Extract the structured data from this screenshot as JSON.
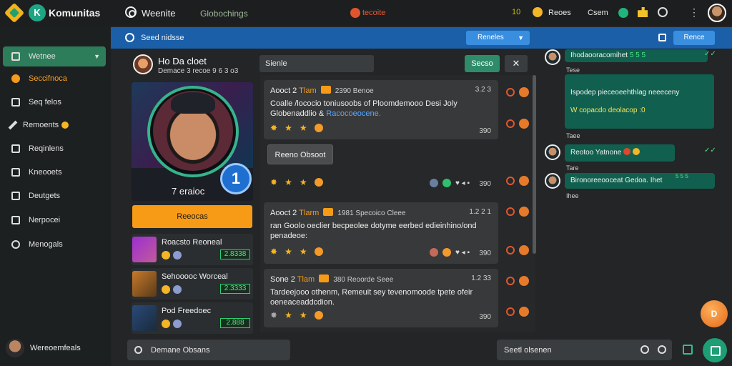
{
  "topbar": {
    "brand": "Komunitas",
    "title": "Weenite",
    "subtitle": "Globochings",
    "status": "tecoite",
    "count": "10",
    "link1": "Reoes",
    "link2": "Csem"
  },
  "sidebar": {
    "items": [
      {
        "label": "Wetnee"
      },
      {
        "label": "Seccifnoca"
      },
      {
        "label": "Seq felos"
      },
      {
        "label": "Remoents"
      },
      {
        "label": "Reqinlens"
      },
      {
        "label": "Kneooets"
      },
      {
        "label": "Deutgets"
      },
      {
        "label": "Nerpocei"
      },
      {
        "label": "Menogals"
      }
    ],
    "user_name": "Wereoemfeals"
  },
  "bluebar": {
    "label": "Seed nidsse",
    "dropdown": "Reneles",
    "button": "Rence"
  },
  "profile": {
    "name": "Ho Da cloet",
    "subtitle": "Demace 3 recoe 9 6 3 o3",
    "hero_label": "7 eraioc",
    "level": "1",
    "action_button": "Reeocas"
  },
  "friends": [
    {
      "name": "Roacsto Reoneal",
      "score": "2.8338"
    },
    {
      "name": "Sehooooc Worceal",
      "score": "2.3333"
    },
    {
      "name": "Pod Freedoec",
      "score": "2.888"
    }
  ],
  "feed": {
    "search_placeholder": "Sienle",
    "button": "Secso",
    "close": "✕",
    "attach_button": "Reeno Obsoot",
    "posts": [
      {
        "author": "Aooct 2",
        "rank": "Tlam",
        "meta": "2390 Benoe",
        "time": "3.2 3",
        "body": "Coalle /lococio toniusoobs of Ploomdemooo Desi Joly",
        "body2": "Globenaddlio &",
        "link": "Racocoeocene.",
        "count": "390"
      },
      {
        "author": "Aooct 2",
        "rank": "Tlarm",
        "meta": "1981 Specoico Cleee",
        "time": "1.2 2 1",
        "body": "ran Goolo oeclier becpeolee dotyme eerbed edieinhino/ond",
        "body2": "penadeoe:",
        "count": "390"
      },
      {
        "author": "Sone 2",
        "rank": "Tlam",
        "meta": "380 Reoorde Seee",
        "time": "1.2 33",
        "body": "Tardeejooo othenm, Remeuit sey tevenomoode tpete ofeir",
        "body2": "oeneaceaddcdion.",
        "count": "390"
      }
    ]
  },
  "chat": {
    "messages": [
      {
        "text": "Ihodaooracomihet",
        "extra": "5 5 5",
        "time": "Tese"
      },
      {
        "text1": "Ispodep pieceoeehthlag neeeceny",
        "text2": "W copacdo deolacop :0",
        "time": "Taee"
      },
      {
        "text": "Reotoo Yatnone",
        "time": "Tare"
      },
      {
        "text": "Bironoreeooceat Gedoa. Ihet",
        "extra": "5 5 5",
        "time": "Ihee"
      }
    ]
  },
  "fab": "D",
  "bottom": {
    "left_label": "Demane Obsans",
    "input_placeholder": "Seetl olsenen"
  }
}
